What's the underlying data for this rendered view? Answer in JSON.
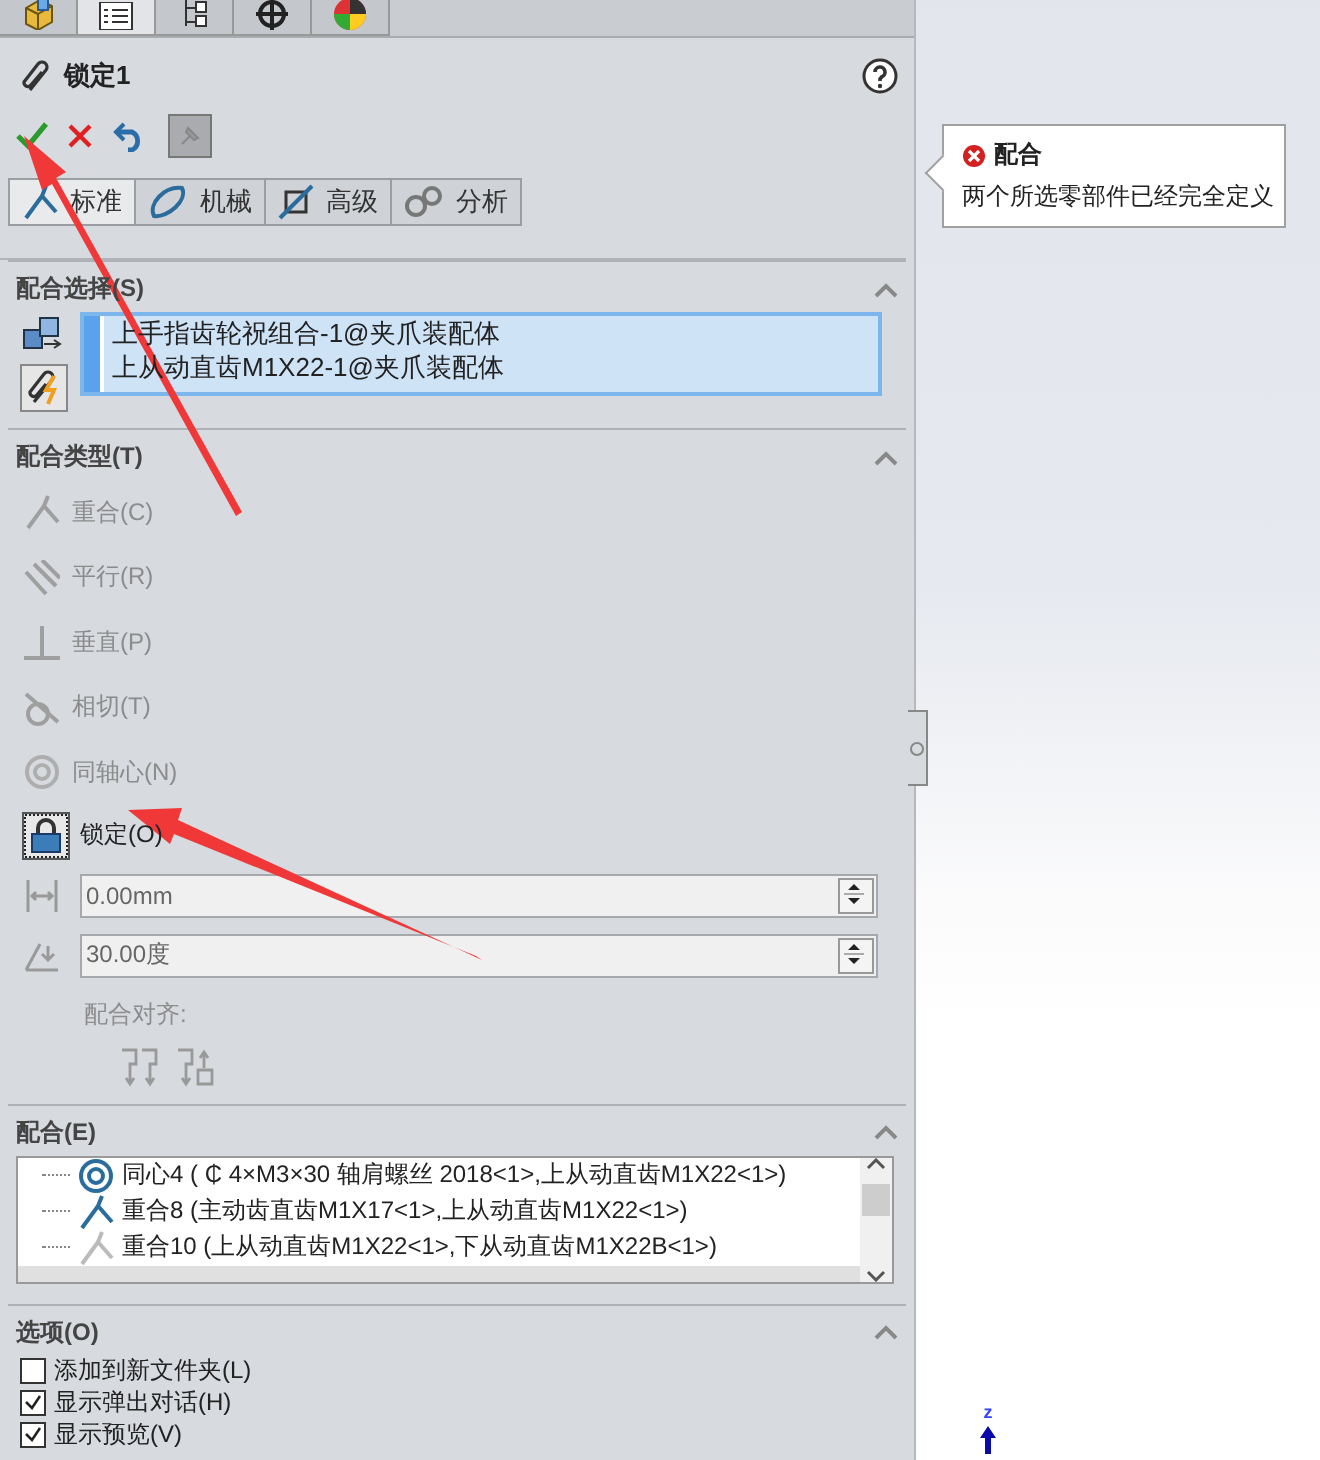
{
  "panel_tabs": [
    {
      "selected": false
    },
    {
      "selected": true
    },
    {
      "selected": false
    },
    {
      "selected": false
    },
    {
      "selected": false
    }
  ],
  "feature": {
    "title": "锁定1"
  },
  "mate_tabs": [
    {
      "label": "标准",
      "selected": true
    },
    {
      "label": "机械",
      "selected": false
    },
    {
      "label": "高级",
      "selected": false
    },
    {
      "label": "分析",
      "selected": false
    }
  ],
  "selections": {
    "title": "配合选择(S)",
    "expanded": true,
    "items": [
      "上手指齿轮祝组合-1@夹爪装配体",
      "上从动直齿M1X22-1@夹爪装配体"
    ]
  },
  "mate_types": {
    "title": "配合类型(T)",
    "expanded": true,
    "items": [
      {
        "label": "重合(C)",
        "selected": false,
        "disabled": true
      },
      {
        "label": "平行(R)",
        "selected": false,
        "disabled": true
      },
      {
        "label": "垂直(P)",
        "selected": false,
        "disabled": true
      },
      {
        "label": "相切(T)",
        "selected": false,
        "disabled": true
      },
      {
        "label": "同轴心(N)",
        "selected": false,
        "disabled": true
      },
      {
        "label": "锁定(O)",
        "selected": true,
        "disabled": false
      }
    ],
    "distance": {
      "value": "0.00mm",
      "disabled": true
    },
    "angle": {
      "value": "30.00度",
      "disabled": true
    },
    "alignment_label": "配合对齐:"
  },
  "mates": {
    "title": "配合(E)",
    "expanded": true,
    "items": [
      {
        "kind": "concentric",
        "label": "同心4 ( ₵ 4×M3×30 轴肩螺丝 2018<1>,上从动直齿M1X22<1>)",
        "active": true
      },
      {
        "kind": "coincident",
        "label": "重合8 (主动齿直齿M1X17<1>,上从动直齿M1X22<1>)",
        "active": true
      },
      {
        "kind": "coincident",
        "label": "重合10 (上从动直齿M1X22<1>,下从动直齿M1X22B<1>)",
        "active": false
      }
    ]
  },
  "options": {
    "title": "选项(O)",
    "expanded": true,
    "items": [
      {
        "label": "添加到新文件夹(L)",
        "checked": false
      },
      {
        "label": "显示弹出对话(H)",
        "checked": true
      },
      {
        "label": "显示预览(V)",
        "checked": true
      }
    ]
  },
  "tooltip": {
    "title": "配合",
    "message": "两个所选零部件已经完全定义"
  },
  "axis": {
    "label": "z"
  }
}
